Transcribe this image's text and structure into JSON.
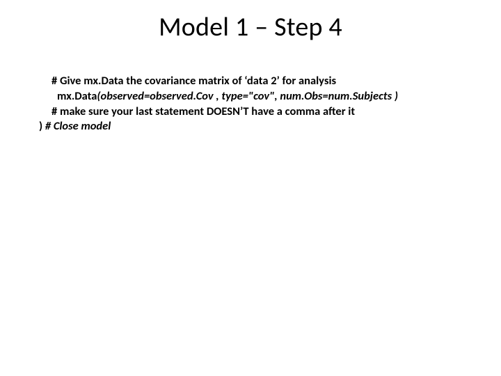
{
  "title": "Model 1 – Step 4",
  "lines": {
    "l1": "# Give mx.Data the covariance matrix of ‘data 2’ for analysis",
    "l2_lead": " mx.Data",
    "l2_rest": "(observed=observed.Cov , type=\"cov\", num.Obs=num.Subjects )",
    "l3": "# make sure your last statement DOESN’T have a comma after it",
    "l4a": ") ",
    "l4b": "# Close model"
  }
}
